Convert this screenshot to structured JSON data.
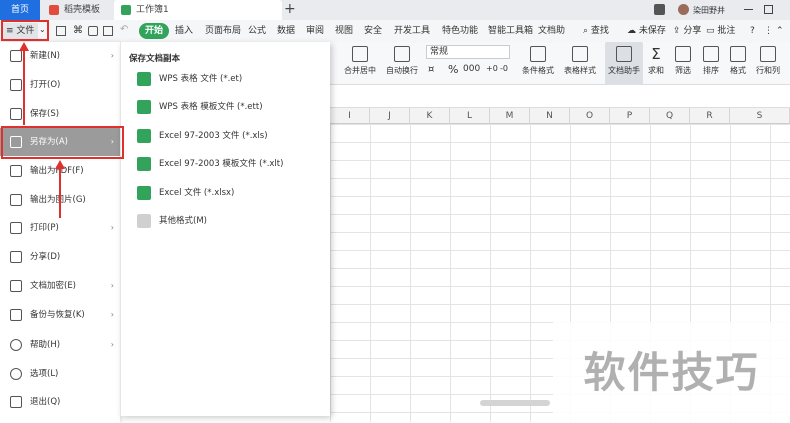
{
  "titlebar": {
    "home_tab": "首页",
    "template_tab": "稻壳模板",
    "doc_tab": "工作簿1",
    "plus": "+",
    "user_name": "染田野井"
  },
  "toolbar": {
    "file_label": "文件",
    "start_label": "开始",
    "menu_tabs": [
      "插入",
      "页面布局",
      "公式",
      "数据",
      "审阅",
      "视图",
      "安全",
      "开发工具",
      "特色功能",
      "智能工具箱",
      "文档助"
    ],
    "search_label": "查找",
    "unsaved_label": "未保存",
    "share_label": "分享",
    "annotate_label": "批注"
  },
  "ribbon": {
    "merge": "合并居中",
    "wrap": "自动换行",
    "format_select": "常规",
    "cond_format": "条件格式",
    "table_style": "表格样式",
    "doc_helper": "文档助手",
    "sum": "求和",
    "filter": "筛选",
    "sort": "排序",
    "format": "格式",
    "rowcol": "行和列"
  },
  "sheet": {
    "columns": [
      "I",
      "J",
      "K",
      "L",
      "M",
      "N",
      "O",
      "P",
      "Q",
      "R",
      "S"
    ]
  },
  "file_menu": {
    "items": [
      {
        "label": "新建(N)",
        "has_arrow": true
      },
      {
        "label": "打开(O)",
        "has_arrow": false
      },
      {
        "label": "保存(S)",
        "has_arrow": false
      },
      {
        "label": "另存为(A)",
        "has_arrow": true
      },
      {
        "label": "输出为PDF(F)",
        "has_arrow": false
      },
      {
        "label": "输出为图片(G)",
        "has_arrow": false
      },
      {
        "label": "打印(P)",
        "has_arrow": true
      },
      {
        "label": "分享(D)",
        "has_arrow": false
      },
      {
        "label": "文档加密(E)",
        "has_arrow": true
      },
      {
        "label": "备份与恢复(K)",
        "has_arrow": true
      },
      {
        "label": "帮助(H)",
        "has_arrow": true
      },
      {
        "label": "选项(L)",
        "has_arrow": false
      },
      {
        "label": "退出(Q)",
        "has_arrow": false
      }
    ]
  },
  "save_as_panel": {
    "title": "保存文档副本",
    "items": [
      "WPS 表格 文件 (*.et)",
      "WPS 表格 模板文件 (*.ett)",
      "Excel 97-2003 文件 (*.xls)",
      "Excel 97-2003 模板文件 (*.xlt)",
      "Excel 文件 (*.xlsx)",
      "其他格式(M)"
    ]
  },
  "watermark": "软件技巧",
  "colors": {
    "accent_green": "#31a35a",
    "home_blue": "#1f6fe0",
    "annotation_red": "#e0302e"
  }
}
